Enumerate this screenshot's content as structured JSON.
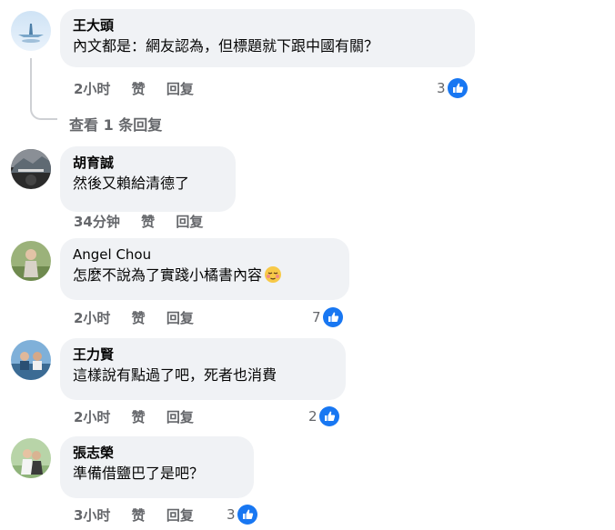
{
  "comments": [
    {
      "author": "王大頭",
      "text": "內文都是：網友認為，但標題就下跟中國有關？",
      "time": "2小时",
      "like_label": "赞",
      "reply_label": "回复",
      "reactions": "3",
      "view_replies": "查看 1 条回复"
    },
    {
      "author": "胡育誠",
      "text": "然後又賴給清德了",
      "time": "34分钟",
      "like_label": "赞",
      "reply_label": "回复"
    },
    {
      "author": "Angel Chou",
      "text": "怎麼不說為了實踐小橘書內容",
      "time": "2小时",
      "like_label": "赞",
      "reply_label": "回复",
      "reactions": "7"
    },
    {
      "author": "王力賢",
      "text": "這樣說有點過了吧，死者也消費",
      "time": "2小时",
      "like_label": "赞",
      "reply_label": "回复",
      "reactions": "2"
    },
    {
      "author": "張志榮",
      "text": "準備借鹽巴了是吧？",
      "time": "3小时",
      "like_label": "赞",
      "reply_label": "回复",
      "reactions": "3"
    }
  ],
  "colors": {
    "bubble": "#f0f2f5",
    "like_blue": "#1877f2",
    "meta_gray": "#65676b"
  }
}
